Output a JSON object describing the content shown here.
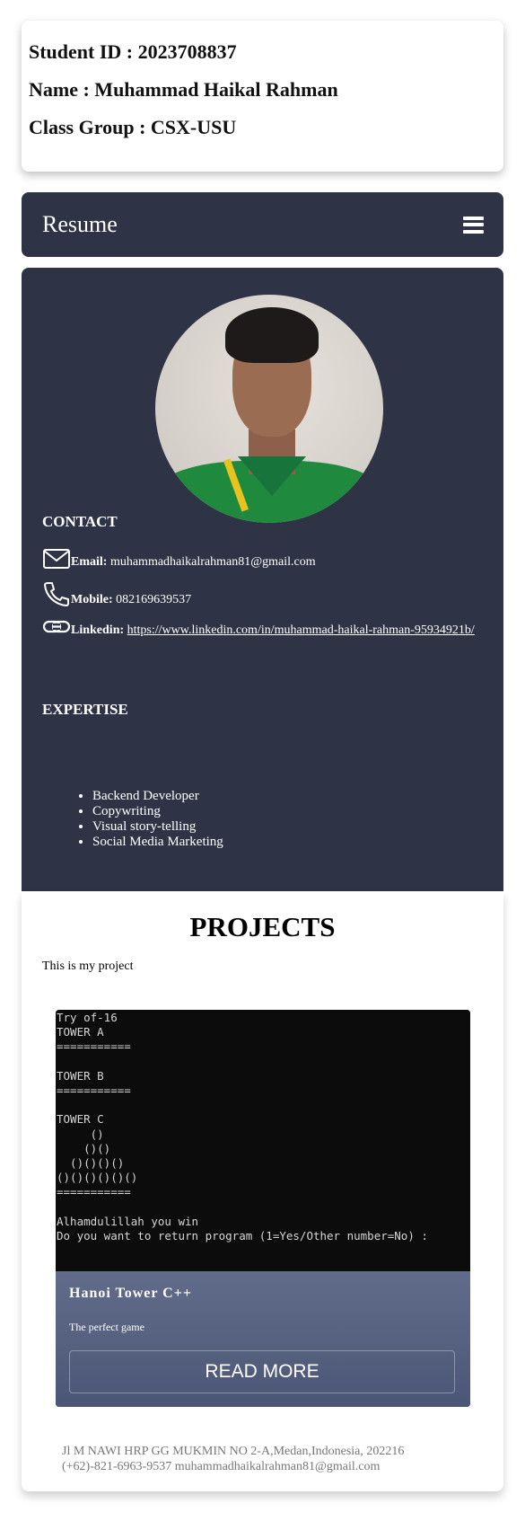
{
  "student": {
    "id_line": "Student ID : 2023708837",
    "name_line": "Name : Muhammad Haikal Rahman",
    "class_line": "Class Group : CSX-USU"
  },
  "navbar": {
    "brand": "Resume",
    "menu_icon": "hamburger-menu-icon"
  },
  "profile": {
    "photo_icon": "profile-photo",
    "contact_title": "CONTACT",
    "email_label": "Email:",
    "email_value": "muhammadhaikalrahman81@gmail.com",
    "mobile_label": "Mobile:",
    "mobile_value": "082169639537",
    "linkedin_label": "Linkedin:",
    "linkedin_value": "https://www.linkedin.com/in/muhammad-haikal-rahman-95934921b/",
    "expertise_title": "EXPERTISE",
    "expertise": [
      "Backend Developer",
      "Copywriting",
      "Visual story-telling",
      "Social Media Marketing"
    ]
  },
  "projects": {
    "title": "PROJECTS",
    "intro": "This is my project",
    "card": {
      "terminal_text": "Try of-16\nTOWER A\n===========\n\nTOWER B\n===========\n\nTOWER C\n     ()\n    ()()\n  ()()()()\n()()()()()()\n===========\n\nAlhamdulillah you win\nDo you want to return program (1=Yes/Other number=No) :",
      "title": "Hanoi Tower C++",
      "description": "The perfect game",
      "button": "READ MORE"
    }
  },
  "footer": {
    "address": "Jl M NAWI HRP GG MUKMIN NO 2-A,Medan,Indonesia, 202216",
    "contact": "(+62)-821-6963-9537 muhammadhaikalrahman81@gmail.com"
  },
  "colors": {
    "dark_panel": "#2e3446",
    "card_body": "#5a6483",
    "terminal_bg": "#0c0c0c"
  }
}
